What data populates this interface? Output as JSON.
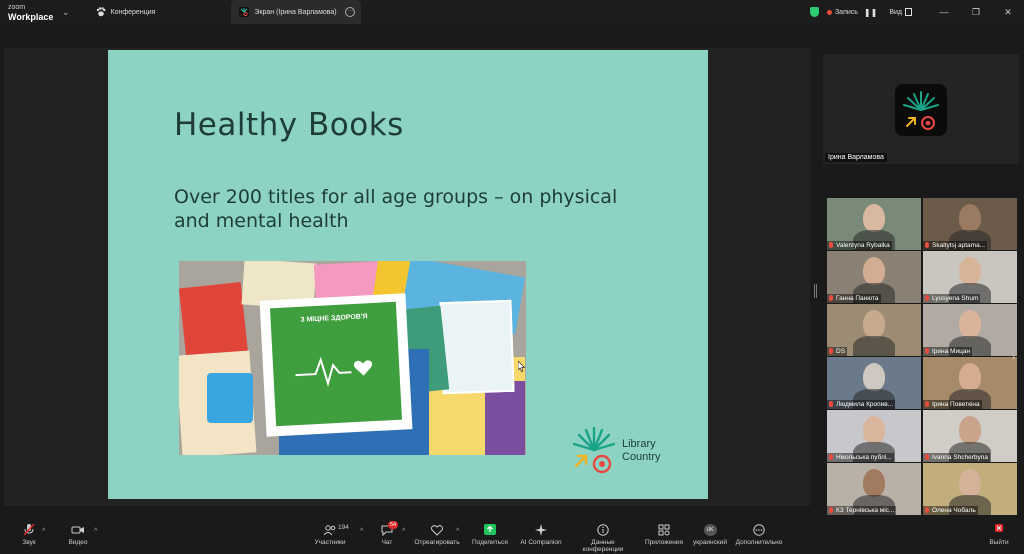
{
  "app": {
    "logo_top": "zoom",
    "logo_bottom": "Workplace"
  },
  "tabs": [
    {
      "label": "Конференция"
    },
    {
      "label": "Экран (Ірина Варламова)"
    }
  ],
  "titlebar_right": {
    "recording": "Запись",
    "view": "Вид"
  },
  "slide": {
    "title": "Healthy Books",
    "subtitle": "Over 200 titles for all age groups – on physical and mental health",
    "photo_book_title": "3 МІЦНЕ ЗДОРОВ'Я",
    "brand_line1": "Library",
    "brand_line2": "Country"
  },
  "self_view": {
    "name": "Ірина Варламова"
  },
  "participants": [
    {
      "name": "Valentyna Rybalka",
      "bg": "#7a8a78",
      "face": "#d8b9a0"
    },
    {
      "name": "Skaltytsj aptama...",
      "bg": "#6c5a4a",
      "face": "#9a7a60"
    },
    {
      "name": "Ганна Панюта",
      "bg": "#8a8074",
      "face": "#d2ad92"
    },
    {
      "name": "Lyusyena Shum",
      "bg": "#c9c6c0",
      "face": "#d8b59a"
    },
    {
      "name": "DS",
      "bg": "#9c8c74",
      "face": "#c7a98c"
    },
    {
      "name": "Ірина Мицан",
      "bg": "#b0aaa2",
      "face": "#d9b49b"
    },
    {
      "name": "Людмила Кропив...",
      "bg": "#6a7a8a",
      "face": "#cfc8c0"
    },
    {
      "name": "Ірина Поветкіна",
      "bg": "#a68a6a",
      "face": "#d6ad8e"
    },
    {
      "name": "Нікольська публі...",
      "bg": "#c8c8cc",
      "face": "#d9b59c"
    },
    {
      "name": "Ivanna Shcherbyna",
      "bg": "#d0ccc6",
      "face": "#c9a38a"
    },
    {
      "name": "КЗ Тернівська міс...",
      "bg": "#b9b0a8",
      "face": "#a17a60"
    },
    {
      "name": "Олена Чобаль",
      "bg": "#c2ad7c",
      "face": "#d5b197"
    }
  ],
  "toolbar": {
    "audio": "Звук",
    "video": "Видео",
    "participants": "Участники",
    "participants_count": "194",
    "chat": "Чат",
    "chat_badge": "54",
    "react": "Отреагировать",
    "share": "Поделиться",
    "ai": "AI Companion",
    "info": "Данные конференции",
    "apps": "Приложения",
    "lang": "украинский",
    "lang_code": "UK",
    "more": "Дополнительно",
    "leave": "Выйти"
  },
  "colors": {
    "slide_bg": "#8dd3c4",
    "slide_text": "#1e3d36",
    "share_green": "#22c55e",
    "danger": "#e02828"
  }
}
